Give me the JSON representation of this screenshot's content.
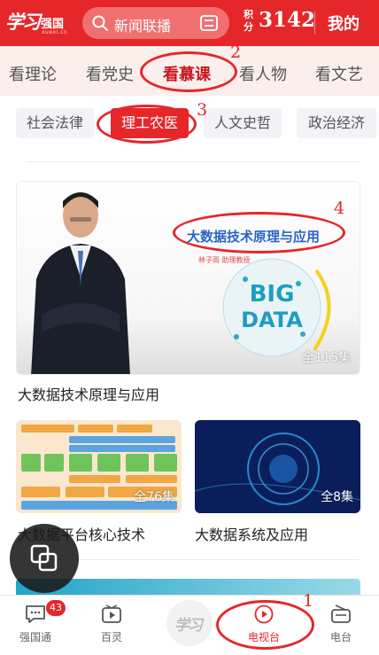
{
  "header": {
    "logo_text": "学习",
    "logo_strong": "强国",
    "logo_sub": "xuexi.cn",
    "search_placeholder": "新闻联播",
    "score_label": "积分",
    "score_value": "3142",
    "mine_label": "我的"
  },
  "channels": [
    {
      "label": "看理论"
    },
    {
      "label": "看党史"
    },
    {
      "label": "看慕课"
    },
    {
      "label": "看人物"
    },
    {
      "label": "看文艺"
    }
  ],
  "categories": [
    {
      "label": "社会法律"
    },
    {
      "label": "理工农医"
    },
    {
      "label": "人文史哲"
    },
    {
      "label": "政治经济"
    }
  ],
  "featured": {
    "image_title": "大数据技术原理与应用",
    "image_subtitle": "林子雨 助理教授",
    "image_badge_1": "BIG",
    "image_badge_2": "DATA",
    "count": "全115集",
    "caption": "大数据技术原理与应用"
  },
  "courses": [
    {
      "count": "全76集",
      "caption": "大数据平台核心技术"
    },
    {
      "count": "全8集",
      "caption": "大数据系统及应用"
    }
  ],
  "bottom_nav": [
    {
      "label": "强国通",
      "badge": "43"
    },
    {
      "label": "百灵"
    },
    {
      "label": "学习"
    },
    {
      "label": "电视台"
    },
    {
      "label": "电台"
    }
  ],
  "annotations": [
    "1",
    "2",
    "3",
    "4"
  ],
  "colors": {
    "brand_red": "#e5272a",
    "annotation_red": "#e5272a"
  }
}
